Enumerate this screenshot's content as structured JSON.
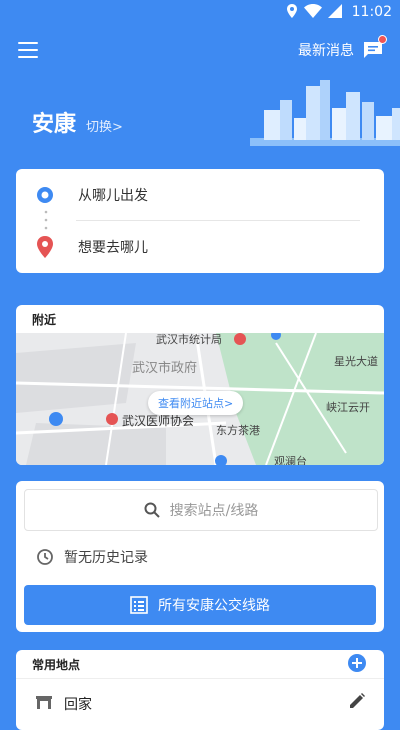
{
  "status_bar": {
    "time": "11:02"
  },
  "header": {
    "messages_label": "最新消息"
  },
  "city": {
    "name": "安康",
    "switch_label": "切换>"
  },
  "route": {
    "from_placeholder": "从哪儿出发",
    "to_placeholder": "想要去哪儿"
  },
  "nearby": {
    "title": "附近",
    "view_stations_label": "查看附近站点>",
    "map_labels": [
      "武汉市统计局",
      "武汉市政府",
      "武汉医师协会",
      "东方茶港",
      "星光大道",
      "峡江云开",
      "观澜台"
    ]
  },
  "search": {
    "placeholder": "搜索站点/线路",
    "history_empty": "暂无历史记录",
    "all_lines_label": "所有安康公交线路"
  },
  "places": {
    "title": "常用地点",
    "items": [
      {
        "label": "回家"
      }
    ]
  },
  "colors": {
    "primary": "#3e8af2",
    "accent_red": "#e55454"
  }
}
